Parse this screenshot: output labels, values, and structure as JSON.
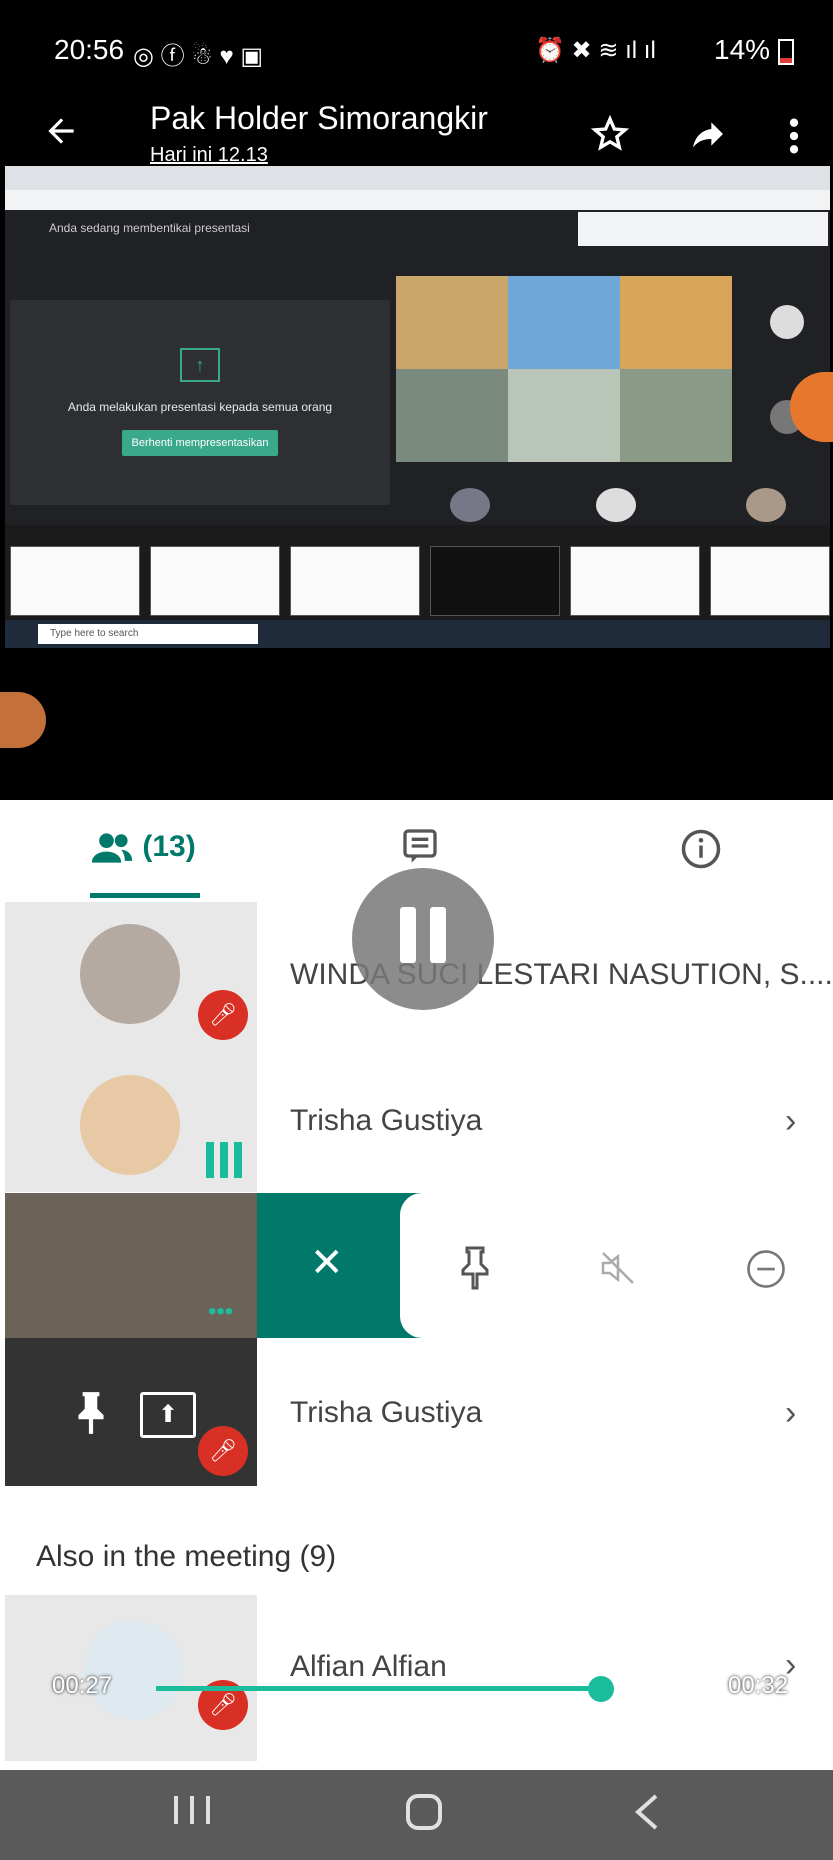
{
  "status": {
    "time": "20:56",
    "battery": "14%"
  },
  "header": {
    "title": "Pak Holder Simorangkir",
    "subtitle": "Hari ini 12.13"
  },
  "screen": {
    "presenting_banner": "Anda sedang membentikai presentasi",
    "present_text": "Anda melakukan presentasi kepada semua orang",
    "stop_btn": "Berhenti mempresentasikan",
    "taskbar_search": "Type here to search"
  },
  "tabs": {
    "people_count": "(13)"
  },
  "participants": [
    {
      "name": "WINDA SUCI LESTARI NASUTION, S...."
    },
    {
      "name": "Trisha Gustiya"
    },
    {
      "name": "Trisha Gustiya"
    }
  ],
  "also_header": "Also in the meeting (9)",
  "also": [
    {
      "name": "Alfian Alfian"
    }
  ],
  "playback": {
    "current": "00:27",
    "total": "00:32",
    "progress": 0.84
  },
  "colors": {
    "accent": "#00796b",
    "progress": "#1abc9c",
    "mute": "#d93025"
  }
}
